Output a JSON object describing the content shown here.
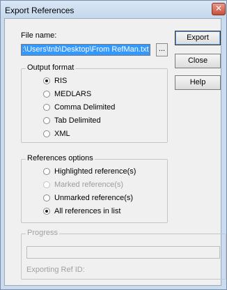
{
  "window": {
    "title": "Export References",
    "close_glyph": "✕"
  },
  "file": {
    "label": "File name:",
    "value": ":\\Users\\tnb\\Desktop\\From RefMan.txt",
    "browse_label": "..."
  },
  "buttons": {
    "export": "Export",
    "close": "Close",
    "help": "Help"
  },
  "output_format": {
    "title": "Output format",
    "options": [
      "RIS",
      "MEDLARS",
      "Comma Delimited",
      "Tab Delimited",
      "XML"
    ],
    "selected": "RIS"
  },
  "references_options": {
    "title": "References options",
    "options": [
      "Highlighted reference(s)",
      "Marked reference(s)",
      "Unmarked reference(s)",
      "All references in list"
    ],
    "disabled": [
      "Marked reference(s)"
    ],
    "selected": "All references in list"
  },
  "progress": {
    "title": "Progress",
    "exporting_label": "Exporting Ref ID:"
  },
  "colors": {
    "selection": "#3399ff",
    "dialog_bg": "#f0f0f0",
    "frame": "#c9dbee",
    "close_button": "#c7503b"
  }
}
